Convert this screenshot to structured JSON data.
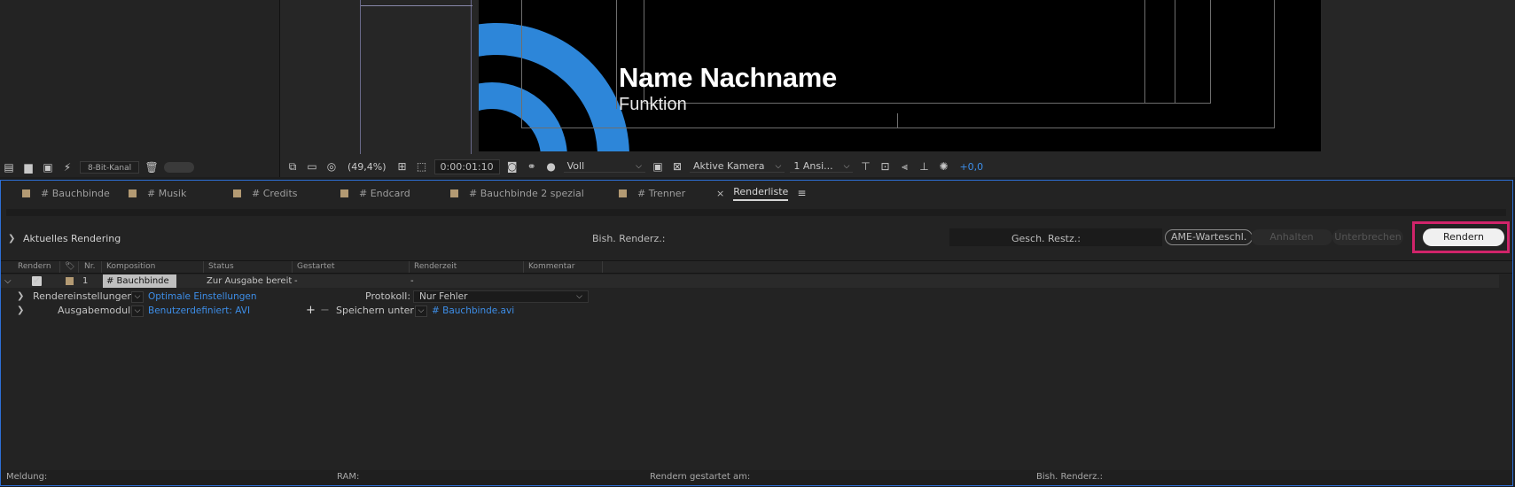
{
  "project": {
    "bit_depth": "8-Bit-Kanal"
  },
  "viewer": {
    "title_name": "Name Nachname",
    "title_function": "Funktion",
    "toolbar": {
      "zoom": "(49,4%)",
      "timecode": "0:00:01:10",
      "resolution": "Voll",
      "camera": "Aktive Kamera",
      "views": "1 Ansi...",
      "exposure": "+0,0"
    }
  },
  "tabs": [
    {
      "label": "# Bauchbinde"
    },
    {
      "label": "# Musik"
    },
    {
      "label": "# Credits"
    },
    {
      "label": "# Endcard"
    },
    {
      "label": "# Bauchbinde 2 spezial"
    },
    {
      "label": "# Trenner"
    },
    {
      "label": "Renderliste",
      "active": true
    }
  ],
  "tab_close": "×",
  "tab_menu": "≡",
  "status": {
    "title": "Aktuelles Rendering",
    "elapsed_label": "Bish. Renderz.:",
    "remaining_label": "Gesch. Restz.:",
    "ame_button": "AME-Warteschl.",
    "pause_button": "Anhalten",
    "stop_button": "Unterbrechen",
    "render_button": "Rendern"
  },
  "columns": {
    "render": "Rendern",
    "nr": "Nr.",
    "comp": "Komposition",
    "status": "Status",
    "started": "Gestartet",
    "render_time": "Renderzeit",
    "comment": "Kommentar"
  },
  "queue_item": {
    "nr": "1",
    "comp": "# Bauchbinde",
    "status": "Zur Ausgabe bereit",
    "started": "-",
    "render_time": "-",
    "render_settings_label": "Rendereinstellungen:",
    "render_settings_value": "Optimale Einstellungen",
    "log_label": "Protokoll:",
    "log_value": "Nur Fehler",
    "output_module_label": "Ausgabemodul:",
    "output_module_value": "Benutzerdefiniert: AVI",
    "output_to_label": "Speichern unter:",
    "output_to_value": "# Bauchbinde.avi"
  },
  "footer": {
    "message": "Meldung:",
    "ram": "RAM:",
    "render_started": "Rendern gestartet am:",
    "elapsed": "Bish. Renderz.:"
  },
  "colors": {
    "accent_blue": "#2d86d9",
    "highlight": "#d0246a",
    "panel_border": "#2d6fd6",
    "label_swatch": "#b39a73"
  }
}
